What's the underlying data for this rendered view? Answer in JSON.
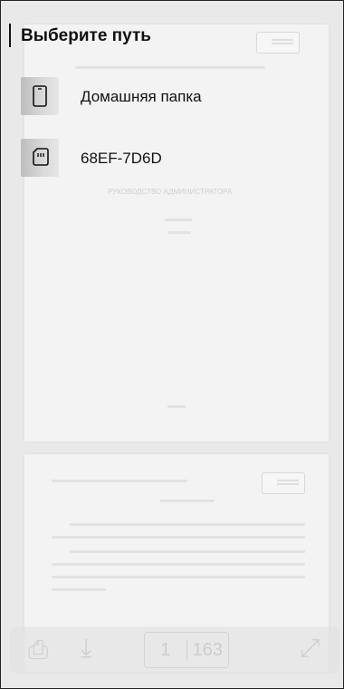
{
  "dialog": {
    "title": "Выберите путь",
    "items": [
      {
        "label": "Домашняя папка",
        "icon": "phone-icon"
      },
      {
        "label": "68EF-7D6D",
        "icon": "sd-card-icon"
      }
    ]
  },
  "background_viewer": {
    "page1_heading": "РУКОВОДСТВО АДМИНИСТРАТОРА",
    "toolbar": {
      "current_page": "1",
      "total_pages": "163"
    }
  }
}
